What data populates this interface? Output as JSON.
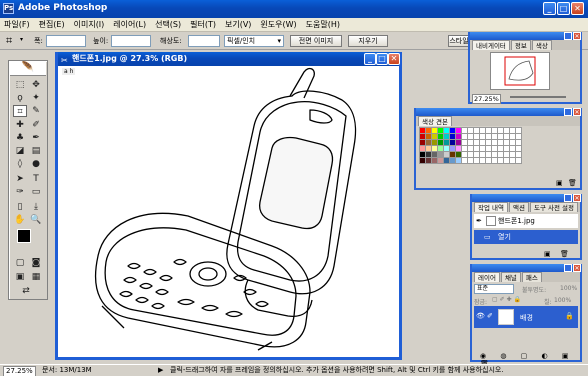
{
  "app": {
    "title": "Adobe Photoshop",
    "window_controls": [
      "minimize",
      "maximize",
      "close"
    ]
  },
  "menu": [
    "파일(F)",
    "편집(E)",
    "이미지(I)",
    "레이어(L)",
    "선택(S)",
    "필터(T)",
    "보기(V)",
    "윈도우(W)",
    "도움말(H)"
  ],
  "options": {
    "width_label": "폭:",
    "height_label": "높이:",
    "resolution_label": "해상도:",
    "unit_select": "픽셀/인치",
    "front_image_button": "전면 이미지",
    "clear_button": "지우기",
    "palette_well_button": "스타일"
  },
  "document": {
    "title": "핸드폰1.jpg @ 27.3% (RGB)",
    "ruler_label": "a h"
  },
  "navigator": {
    "tabs": [
      "내비게이터",
      "정보",
      "색상"
    ],
    "zoom": "27.25%"
  },
  "swatches_panel": {
    "tabs": [
      "색상 견본"
    ],
    "colors": [
      "#ff0000",
      "#ff6600",
      "#ffff00",
      "#00ff00",
      "#00ffff",
      "#0000ff",
      "#ff00ff",
      "#ffffff",
      "#ffffff",
      "#ffffff",
      "#ffffff",
      "#ffffff",
      "#ffffff",
      "#ffffff",
      "#ffffff",
      "#ffffff",
      "#ffffff",
      "#cc0000",
      "#cc6600",
      "#cccc00",
      "#00cc00",
      "#00cccc",
      "#0000cc",
      "#cc00cc",
      "#ffffff",
      "#ffffff",
      "#ffffff",
      "#ffffff",
      "#ffffff",
      "#ffffff",
      "#ffffff",
      "#ffffff",
      "#ffffff",
      "#ffffff",
      "#990000",
      "#996633",
      "#999900",
      "#009900",
      "#009999",
      "#000099",
      "#990099",
      "#ffffff",
      "#ffffff",
      "#ffffff",
      "#ffffff",
      "#ffffff",
      "#ffffff",
      "#ffffff",
      "#ffffff",
      "#ffffff",
      "#ffffff",
      "#ff9999",
      "#ffcc99",
      "#ffff99",
      "#99ff99",
      "#99ffff",
      "#9999ff",
      "#ff99ff",
      "#ffffff",
      "#ffffff",
      "#ffffff",
      "#ffffff",
      "#ffffff",
      "#ffffff",
      "#ffffff",
      "#ffffff",
      "#ffffff",
      "#ffffff",
      "#000000",
      "#333333",
      "#666666",
      "#999999",
      "#cccccc",
      "#663300",
      "#336600",
      "#ffffff",
      "#ffffff",
      "#ffffff",
      "#ffffff",
      "#ffffff",
      "#ffffff",
      "#ffffff",
      "#ffffff",
      "#ffffff",
      "#ffffff",
      "#330000",
      "#663333",
      "#996666",
      "#cc9999",
      "#336699",
      "#6699cc",
      "#99ccff",
      "#ffffff",
      "#ffffff",
      "#ffffff",
      "#ffffff",
      "#ffffff",
      "#ffffff",
      "#ffffff",
      "#ffffff",
      "#ffffff",
      "#ffffff"
    ]
  },
  "history": {
    "tabs": [
      "작업 내역",
      "액션",
      "도구 사전 설정"
    ],
    "snapshot": "핸드폰1.jpg",
    "steps": [
      "열기"
    ]
  },
  "layers": {
    "tabs": [
      "레이어",
      "채널",
      "패스"
    ],
    "blend_mode": "표준",
    "opacity_label": "불투명도:",
    "opacity": "100%",
    "lock_label": "잠금:",
    "fill_label": "칠:",
    "fill": "100%",
    "layer_name": "배경"
  },
  "status": {
    "zoom": "27.25%",
    "doc_info": "문서: 13M/13M",
    "hint": "클릭-드래그하여 자를 프레임을 정의하십시오. 추가 옵션을 사용하려면 Shift, Alt 및 Ctrl 키를 함께 사용하십시오."
  }
}
